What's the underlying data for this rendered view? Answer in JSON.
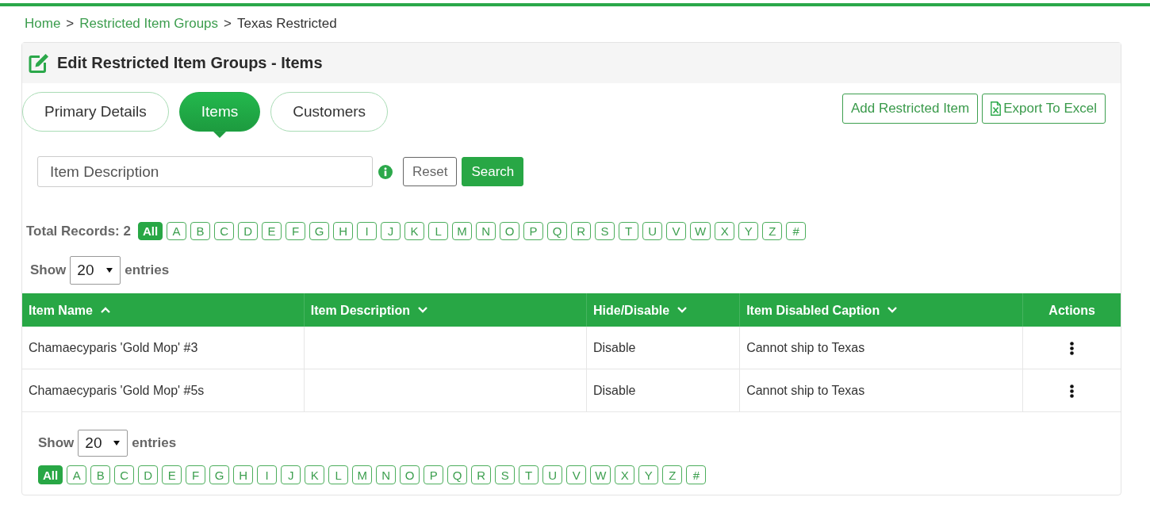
{
  "breadcrumb": [
    {
      "kind": "link",
      "text": "Home"
    },
    {
      "kind": "separator",
      "text": ">"
    },
    {
      "kind": "link",
      "text": "Restricted Item Groups"
    },
    {
      "kind": "separator",
      "text": ">"
    },
    {
      "kind": "current",
      "text": "Texas Restricted"
    }
  ],
  "panel": {
    "title": "Edit Restricted Item Groups - Items"
  },
  "tabs": [
    {
      "label": "Primary Details",
      "selected": false
    },
    {
      "label": "Items",
      "selected": true
    },
    {
      "label": "Customers",
      "selected": false
    }
  ],
  "actions": [
    {
      "kind": "add",
      "label": "Add Restricted Item"
    },
    {
      "kind": "export",
      "label": "Export To Excel"
    }
  ],
  "search": {
    "placeholder": "Item Description",
    "buttons": [
      {
        "kind": "reset",
        "label": "Reset"
      },
      {
        "kind": "search",
        "label": "Search"
      }
    ]
  },
  "records": {
    "total": "Total Records: 2",
    "letters": [
      {
        "label": "All",
        "selected": true
      },
      {
        "label": "A",
        "selected": false
      },
      {
        "label": "B",
        "selected": false
      },
      {
        "label": "C",
        "selected": false
      },
      {
        "label": "D",
        "selected": false
      },
      {
        "label": "E",
        "selected": false
      },
      {
        "label": "F",
        "selected": false
      },
      {
        "label": "G",
        "selected": false
      },
      {
        "label": "H",
        "selected": false
      },
      {
        "label": "I",
        "selected": false
      },
      {
        "label": "J",
        "selected": false
      },
      {
        "label": "K",
        "selected": false
      },
      {
        "label": "L",
        "selected": false
      },
      {
        "label": "M",
        "selected": false
      },
      {
        "label": "N",
        "selected": false
      },
      {
        "label": "O",
        "selected": false
      },
      {
        "label": "P",
        "selected": false
      },
      {
        "label": "Q",
        "selected": false
      },
      {
        "label": "R",
        "selected": false
      },
      {
        "label": "S",
        "selected": false
      },
      {
        "label": "T",
        "selected": false
      },
      {
        "label": "U",
        "selected": false
      },
      {
        "label": "V",
        "selected": false
      },
      {
        "label": "W",
        "selected": false
      },
      {
        "label": "X",
        "selected": false
      },
      {
        "label": "Y",
        "selected": false
      },
      {
        "label": "Z",
        "selected": false
      },
      {
        "label": "#",
        "selected": false
      }
    ]
  },
  "page_length_top": {
    "label_before": "Show",
    "value": "20",
    "label_after": "entries"
  },
  "table": {
    "columns": [
      {
        "kind": "text",
        "label": "Item Name",
        "sortable": true,
        "sorted": true
      },
      {
        "kind": "text",
        "label": "Item Description",
        "sortable": true,
        "sorted": false
      },
      {
        "kind": "text",
        "label": "Hide/Disable",
        "sortable": true,
        "sorted": false
      },
      {
        "kind": "text",
        "label": "Item Disabled Caption",
        "sortable": true,
        "sorted": false
      },
      {
        "kind": "actions",
        "label": "Actions",
        "sortable": false,
        "sorted": false
      }
    ],
    "rows": [
      {
        "item_name": "Chamaecyparis 'Gold Mop' #3",
        "hide_disable": "Disable",
        "disabled_caption": "Cannot ship to Texas"
      },
      {
        "item_name": "Chamaecyparis 'Gold Mop' #5s",
        "hide_disable": "Disable",
        "disabled_caption": "Cannot ship to Texas"
      }
    ]
  },
  "page_length_bottom": {
    "label_before": "Show",
    "value": "20",
    "label_after": "entries"
  },
  "letters_bottom": [
    {
      "label": "All",
      "selected": true
    },
    {
      "label": "A",
      "selected": false
    },
    {
      "label": "B",
      "selected": false
    },
    {
      "label": "C",
      "selected": false
    },
    {
      "label": "D",
      "selected": false
    },
    {
      "label": "E",
      "selected": false
    },
    {
      "label": "F",
      "selected": false
    },
    {
      "label": "G",
      "selected": false
    },
    {
      "label": "H",
      "selected": false
    },
    {
      "label": "I",
      "selected": false
    },
    {
      "label": "J",
      "selected": false
    },
    {
      "label": "K",
      "selected": false
    },
    {
      "label": "L",
      "selected": false
    },
    {
      "label": "M",
      "selected": false
    },
    {
      "label": "N",
      "selected": false
    },
    {
      "label": "O",
      "selected": false
    },
    {
      "label": "P",
      "selected": false
    },
    {
      "label": "Q",
      "selected": false
    },
    {
      "label": "R",
      "selected": false
    },
    {
      "label": "S",
      "selected": false
    },
    {
      "label": "T",
      "selected": false
    },
    {
      "label": "U",
      "selected": false
    },
    {
      "label": "V",
      "selected": false
    },
    {
      "label": "W",
      "selected": false
    },
    {
      "label": "X",
      "selected": false
    },
    {
      "label": "Y",
      "selected": false
    },
    {
      "label": "Z",
      "selected": false
    },
    {
      "label": "#",
      "selected": false
    }
  ]
}
